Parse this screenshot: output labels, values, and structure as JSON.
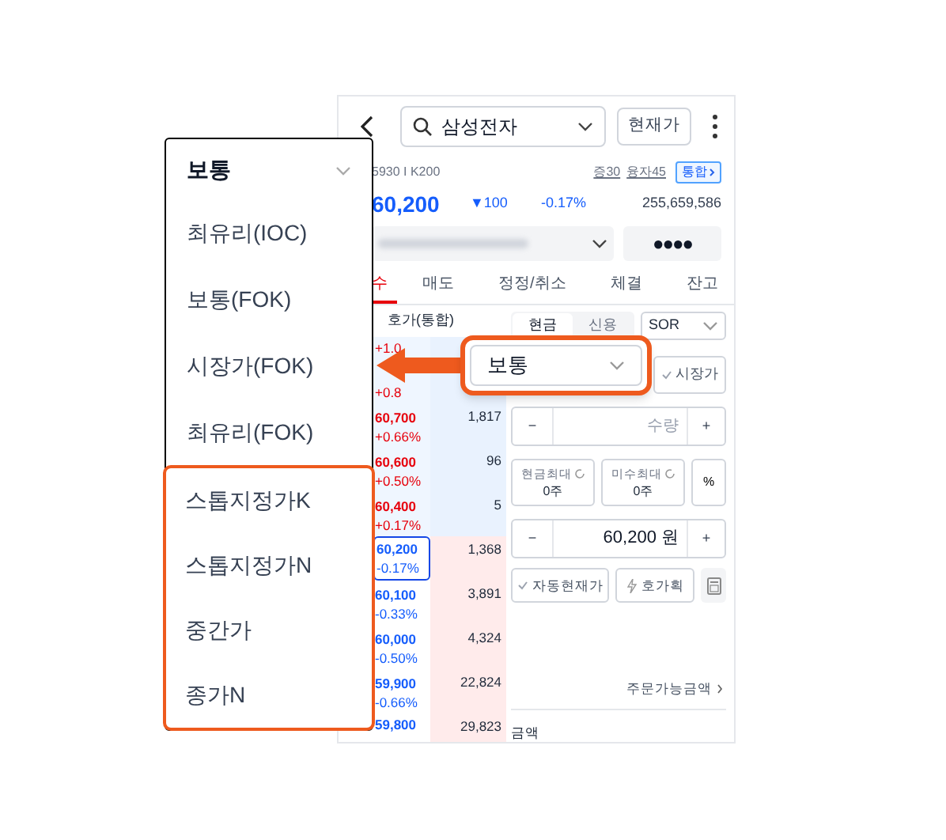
{
  "header": {
    "search": {
      "value": "삼성전자"
    },
    "price_button": "현재가"
  },
  "info": {
    "code": "5930 I K200",
    "links": [
      "증30",
      "융자45"
    ],
    "badge": "통합"
  },
  "quote": {
    "price": "60,200",
    "change": "▼100",
    "rate": "-0.17%",
    "volume": "255,659,586"
  },
  "account": {
    "masked": "●●●●"
  },
  "tabs": [
    {
      "label": "수",
      "selected": true
    },
    {
      "label": "매도",
      "selected": false
    },
    {
      "label": "정정/취소",
      "selected": false
    },
    {
      "label": "체결",
      "selected": false
    },
    {
      "label": "잔고",
      "selected": false
    }
  ],
  "order_book": {
    "title": "호가(통합)",
    "rows": [
      {
        "rate": "+1.0",
        "kind": "ask",
        "selected": false
      },
      {
        "rate": "+0.8",
        "kind": "ask",
        "selected": false
      },
      {
        "price": "60,700",
        "rate": "+0.66%",
        "qty": "1,817",
        "kind": "ask",
        "selected": false
      },
      {
        "price": "60,600",
        "rate": "+0.50%",
        "qty": "96",
        "kind": "ask",
        "selected": false
      },
      {
        "price": "60,400",
        "rate": "+0.17%",
        "qty": "5",
        "kind": "ask",
        "selected": false
      },
      {
        "price": "60,200",
        "rate": "-0.17%",
        "qty": "1,368",
        "kind": "bid",
        "selected": true
      },
      {
        "price": "60,100",
        "rate": "-0.33%",
        "qty": "3,891",
        "kind": "bid",
        "selected": false
      },
      {
        "price": "60,000",
        "rate": "-0.50%",
        "qty": "4,324",
        "kind": "bid",
        "selected": false
      },
      {
        "price": "59,900",
        "rate": "-0.66%",
        "qty": "22,824",
        "kind": "bid",
        "selected": false
      },
      {
        "price": "59,800",
        "qty": "29,823",
        "kind": "bid",
        "selected": false
      }
    ]
  },
  "order_form": {
    "account_type": [
      {
        "label": "현금",
        "selected": true
      },
      {
        "label": "신용",
        "selected": false
      }
    ],
    "route": "SOR",
    "market_price": {
      "label": "시장가",
      "checked": false
    },
    "quantity": {
      "minus": "−",
      "placeholder": "수량",
      "plus": "+"
    },
    "max_buttons": [
      {
        "label": "현금최대",
        "value": "0주"
      },
      {
        "label": "미수최대",
        "value": "0주"
      }
    ],
    "percent": "%",
    "price_input": {
      "minus": "−",
      "value": "60,200 원",
      "plus": "+"
    },
    "auto_price": {
      "label": "자동현재가",
      "checked": false
    },
    "tick_button": "호가획",
    "available_link": "주문가능금액",
    "amount_label": "금액"
  },
  "order_type_dropdown": {
    "selected_label": "보통",
    "options": [
      {
        "label": "최유리(IOC)",
        "highlighted": false
      },
      {
        "label": "보통(FOK)",
        "highlighted": false
      },
      {
        "label": "시장가(FOK)",
        "highlighted": false
      },
      {
        "label": "최유리(FOK)",
        "highlighted": false
      },
      {
        "label": "스톱지정가K",
        "highlighted": true
      },
      {
        "label": "스톱지정가N",
        "highlighted": true
      },
      {
        "label": "중간가",
        "highlighted": true
      },
      {
        "label": "종가N",
        "highlighted": true
      }
    ]
  },
  "callout": {
    "label": "보통"
  }
}
